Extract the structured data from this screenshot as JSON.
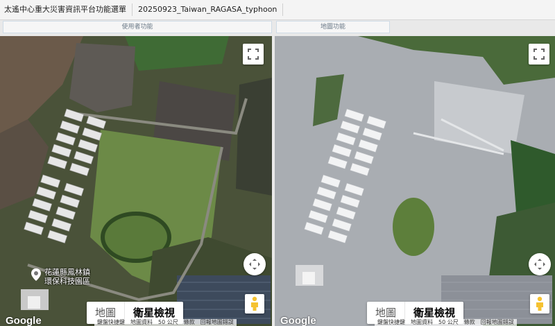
{
  "topbar": {
    "menu_title": "太遙中心重大災害資訊平台功能選單",
    "event_name": "20250923_Taiwan_RAGASA_typhoon"
  },
  "panels": {
    "left_header": "使用者功能",
    "right_header": "地圖功能"
  },
  "map_left": {
    "type_map": "地圖",
    "type_satellite": "衛星檢視",
    "poi_line1": "花蓮縣鳳林鎮",
    "poi_line2": "環保科技園區",
    "google": "Google",
    "attrib": [
      "鍵盤快捷鍵",
      "地圖資料",
      "50 公尺",
      "條款",
      "回報地圖錯誤"
    ]
  },
  "map_right": {
    "type_map": "地圖",
    "type_satellite": "衛星檢視",
    "google": "Google",
    "attrib": [
      "鍵盤快捷鍵",
      "地圖資料",
      "50 公尺",
      "條款",
      "回報地圖錯誤"
    ]
  },
  "icons": [
    "fullscreen-icon",
    "move-icon",
    "pegman-icon",
    "place-marker-icon"
  ],
  "colors": {
    "accent": "#f5c232",
    "topbar": "#f4f4f4"
  }
}
